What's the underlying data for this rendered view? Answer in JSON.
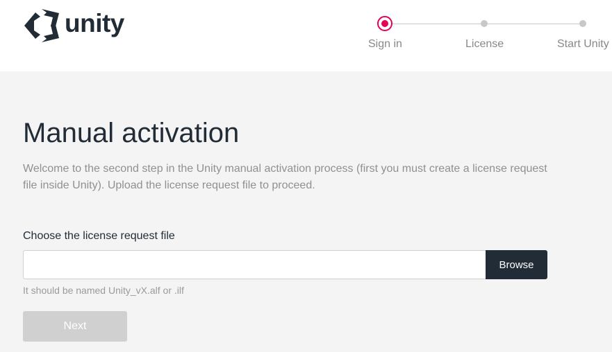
{
  "header": {
    "logo_text": "unity",
    "steps": [
      {
        "label": "Sign in",
        "state": "active"
      },
      {
        "label": "License",
        "state": "pending"
      },
      {
        "label": "Start Unity",
        "state": "pending"
      }
    ]
  },
  "main": {
    "title": "Manual activation",
    "intro": "Welcome to the second step in the Unity manual activation process (first you must create a license request file inside Unity). Upload the license request file to proceed.",
    "file_field": {
      "label": "Choose the license request file",
      "value": "",
      "browse_label": "Browse",
      "hint": "It should be named Unity_vX.alf or .ilf"
    },
    "next_label": "Next"
  },
  "colors": {
    "accent": "#e50059",
    "dark": "#222c37",
    "background": "#f4f4f4",
    "disabled": "#d0d0d0"
  },
  "icons": [
    "unity-logo-icon"
  ]
}
